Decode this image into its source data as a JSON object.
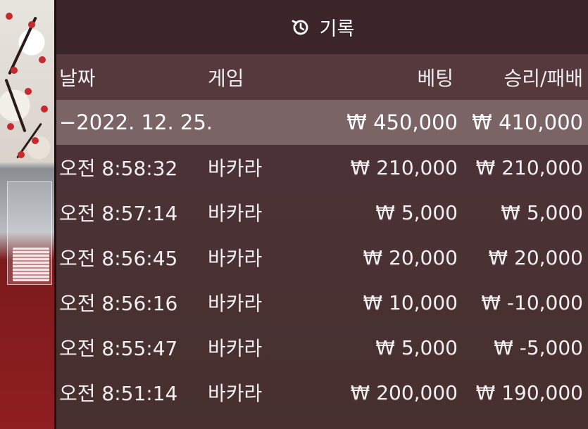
{
  "header": {
    "title": "기록",
    "icon": "history-icon"
  },
  "columns": {
    "date": "날짜",
    "game": "게임",
    "bet": "베팅",
    "result": "승리/패배"
  },
  "summary": {
    "date": "−2022. 12. 25.",
    "bet": "₩ 450,000",
    "result": "₩ 410,000"
  },
  "rows": [
    {
      "time": "오전 8:58:32",
      "game": "바카라",
      "bet": "₩ 210,000",
      "result": "₩ 210,000"
    },
    {
      "time": "오전 8:57:14",
      "game": "바카라",
      "bet": "₩ 5,000",
      "result": "₩ 5,000"
    },
    {
      "time": "오전 8:56:45",
      "game": "바카라",
      "bet": "₩ 20,000",
      "result": "₩ 20,000"
    },
    {
      "time": "오전 8:56:16",
      "game": "바카라",
      "bet": "₩ 10,000",
      "result": "₩ -10,000"
    },
    {
      "time": "오전 8:55:47",
      "game": "바카라",
      "bet": "₩ 5,000",
      "result": "₩ -5,000"
    },
    {
      "time": "오전 8:51:14",
      "game": "바카라",
      "bet": "₩ 200,000",
      "result": "₩ 190,000"
    }
  ]
}
